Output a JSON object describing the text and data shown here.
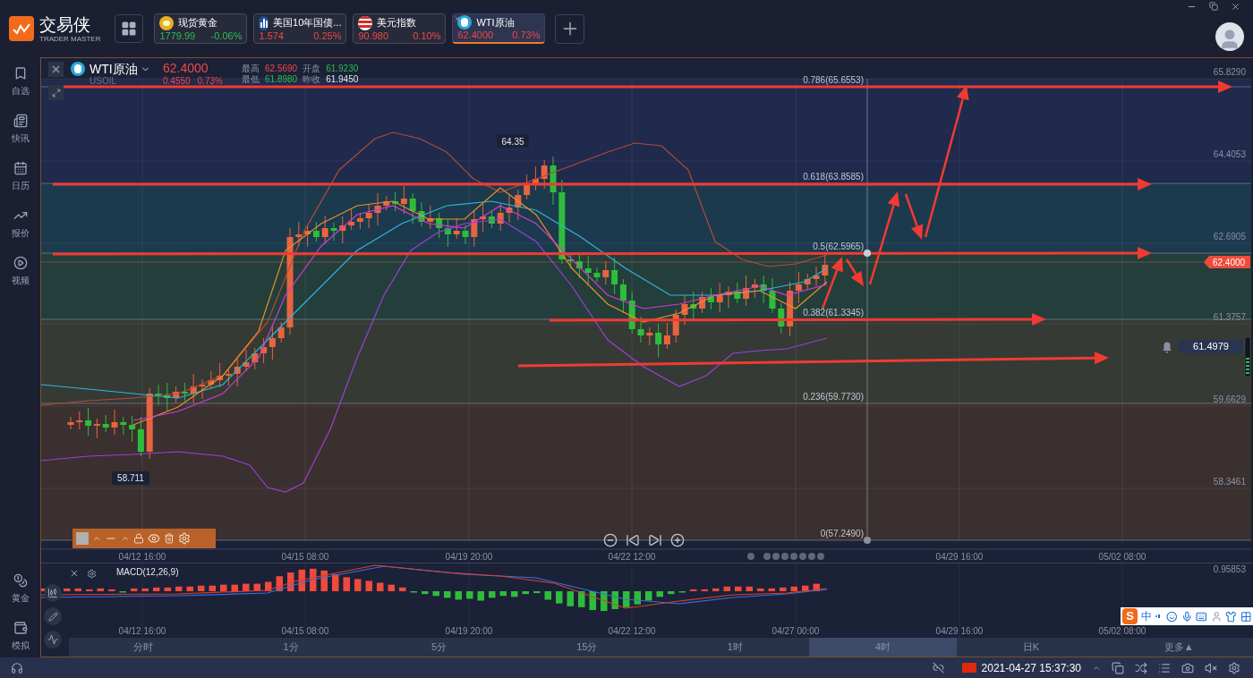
{
  "app": {
    "logo_text": "交易侠",
    "logo_subtext": "TRADER MASTER"
  },
  "quote_tabs": [
    {
      "kind": "coin",
      "name": "现货黄金",
      "price": "1779.99",
      "change": "-0.06%",
      "color": "#2ebd4e",
      "selected": false
    },
    {
      "kind": "bars",
      "name": "美国10年国债...",
      "price": "1.574",
      "change": "0.25%",
      "color": "#f04848",
      "selected": false
    },
    {
      "kind": "flag",
      "name": "美元指数",
      "price": "90.980",
      "change": "0.10%",
      "color": "#f04848",
      "selected": false
    },
    {
      "kind": "oil",
      "name": "WTI原油",
      "price": "62.4000",
      "change": "0.73%",
      "color": "#f04848",
      "selected": true
    }
  ],
  "sidebar": {
    "items": [
      {
        "kind": "bookmark",
        "label": "自选"
      },
      {
        "kind": "news",
        "label": "快讯"
      },
      {
        "kind": "calendar",
        "label": "日历"
      },
      {
        "kind": "trend",
        "label": "报价"
      },
      {
        "kind": "video",
        "label": "视频"
      }
    ],
    "bottom_items": [
      {
        "kind": "gold",
        "label": "黄金"
      },
      {
        "kind": "wallet",
        "label": "模拟"
      }
    ]
  },
  "chart": {
    "name": "WTI原油",
    "symbol": "USOIL",
    "price": "62.4000",
    "change": "0.4550",
    "change_pct": "0.73%",
    "stats": [
      {
        "label": "最高",
        "value": "62.5690",
        "color": "#f04848"
      },
      {
        "label": "开盘",
        "value": "61.9230",
        "color": "#2ebd4e"
      },
      {
        "label": "最低",
        "value": "61.8980",
        "color": "#2ebd4e"
      },
      {
        "label": "昨收",
        "value": "61.9450",
        "color": "#e6e8ee"
      }
    ],
    "fib_levels": [
      "0.786(65.6553)",
      "0.618(63.8585)",
      "0.5(62.5965)",
      "0.382(61.3345)",
      "0.236(59.7730)",
      "0(57.2490)"
    ],
    "price_axis": [
      "65.8290",
      "64.4053",
      "62.6905",
      "61.3757",
      "59.6629",
      "58.3461"
    ],
    "time_axis": [
      "04/12 16:00",
      "04/15 08:00",
      "04/19 20:00",
      "04/22 12:00",
      "04/29 16:00",
      "05/02 08:00"
    ],
    "high_marker": "64.35",
    "low_marker": "58.711",
    "current_price": "62.4000",
    "alert_price": "61.4979"
  },
  "macd": {
    "title": "MACD(12,26,9)",
    "value": "0.95853",
    "time_axis": [
      "04/12 16:00",
      "04/15 08:00",
      "04/19 20:00",
      "04/22 12:00",
      "04/27 00:00",
      "04/29 16:00",
      "05/02 08:00"
    ]
  },
  "periods": [
    {
      "label": "分时",
      "selected": false
    },
    {
      "label": "1分",
      "selected": false
    },
    {
      "label": "5分",
      "selected": false
    },
    {
      "label": "15分",
      "selected": false
    },
    {
      "label": "1时",
      "selected": false
    },
    {
      "label": "4时",
      "selected": true
    },
    {
      "label": "日K",
      "selected": false
    },
    {
      "label": "更多▲",
      "selected": false
    }
  ],
  "ime": {
    "logo": "S",
    "mode": "中"
  },
  "status_bar": {
    "datetime": "2021-04-27 15:37:30"
  }
}
